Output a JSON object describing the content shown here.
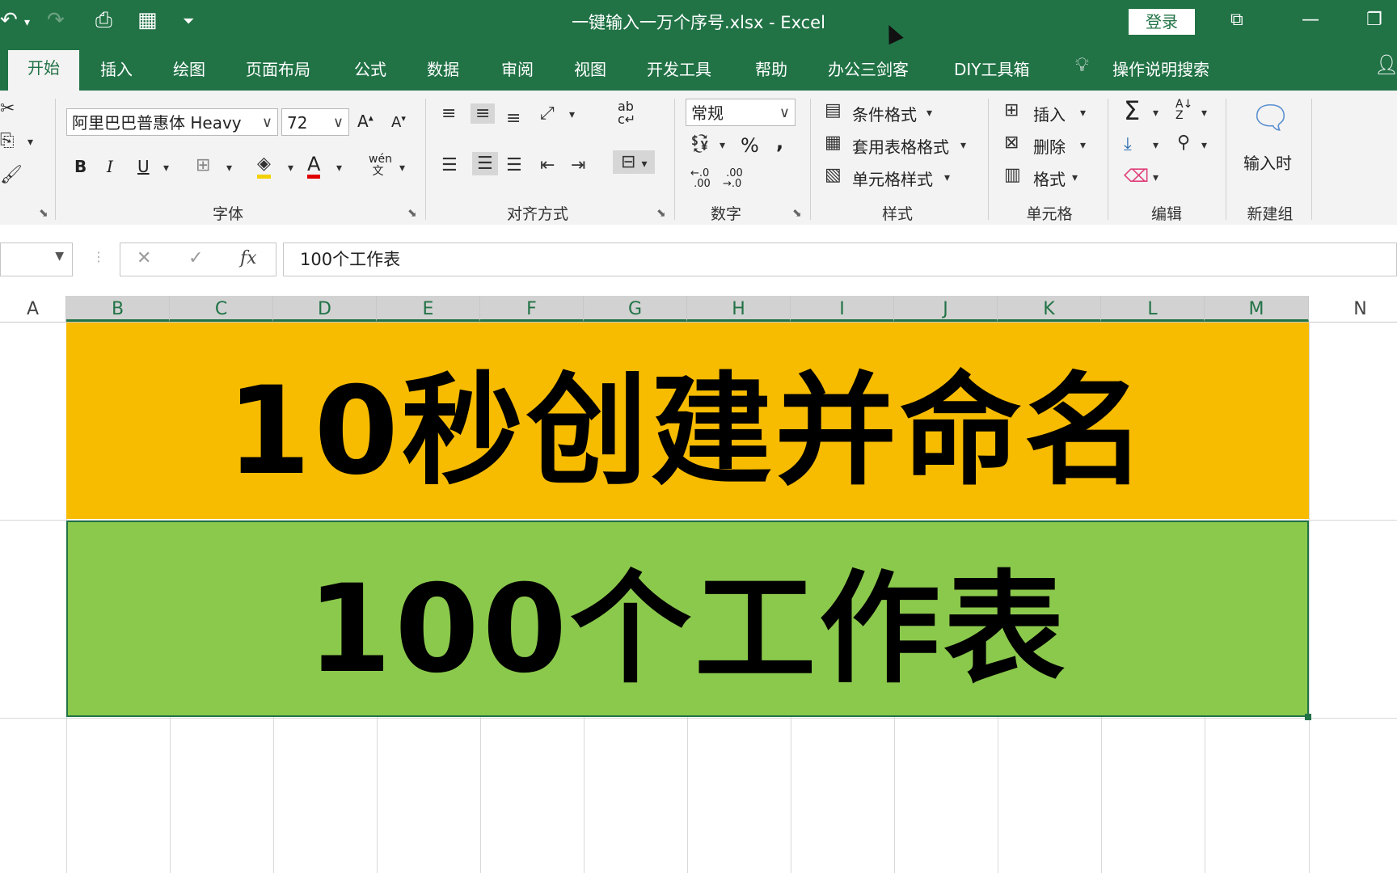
{
  "titlebar": {
    "title": "一键输入一万个序号.xlsx  -  Excel",
    "login": "登录",
    "accent": "#217346"
  },
  "tabs": [
    "开始",
    "插入",
    "绘图",
    "页面布局",
    "公式",
    "数据",
    "审阅",
    "视图",
    "开发工具",
    "帮助",
    "办公三剑客",
    "DIY工具箱",
    "操作说明搜索"
  ],
  "ribbon": {
    "font": {
      "name": "阿里巴巴普惠体 Heavy",
      "size": "72",
      "label": "字体"
    },
    "align": {
      "label": "对齐方式"
    },
    "number": {
      "format": "常规",
      "label": "数字"
    },
    "styles": {
      "conditional": "条件格式",
      "table": "套用表格格式",
      "cell": "单元格样式",
      "label": "样式"
    },
    "cells": {
      "insert": "插入",
      "delete": "删除",
      "format": "格式",
      "label": "单元格"
    },
    "editing": {
      "label": "编辑"
    },
    "newgroup": {
      "input_time": "输入时",
      "label": "新建组"
    }
  },
  "formula_bar": {
    "value": "100个工作表"
  },
  "columns": [
    "A",
    "B",
    "C",
    "D",
    "E",
    "F",
    "G",
    "H",
    "I",
    "J",
    "K",
    "L",
    "M",
    "N"
  ],
  "cells": {
    "banner1": {
      "text": "10秒创建并命名",
      "color": "#f7bb00"
    },
    "banner2": {
      "text": "100个工作表",
      "color": "#8bc94c"
    }
  }
}
